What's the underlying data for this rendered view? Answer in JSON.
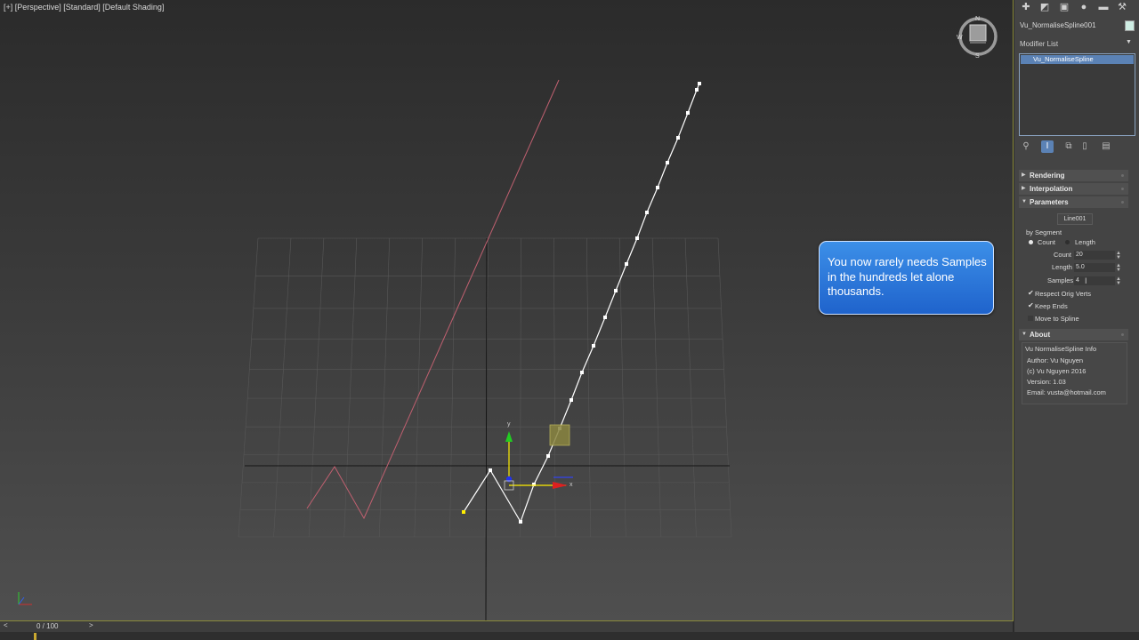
{
  "viewport": {
    "label": "[+] [Perspective] [Standard] [Default Shading]"
  },
  "viewcube": {
    "north": "N",
    "south": "S",
    "west": "W"
  },
  "callout": {
    "text": "You now rarely needs Samples in the hundreds let alone thousands."
  },
  "panel": {
    "object_name": "Vu_NormaliseSpline001",
    "swatch_color": "#cfeee4",
    "modifier_list_label": "Modifier List",
    "modifier_stack": [
      "Vu_NormaliseSpline"
    ],
    "rollouts": {
      "rendering": "Rendering",
      "interpolation": "Interpolation",
      "parameters": "Parameters",
      "about": "About"
    },
    "parameters": {
      "pick_button": "Line001",
      "mode_group": "by Segment",
      "radio_count": "Count",
      "radio_length": "Length",
      "radio_selected": "Count",
      "count_label": "Count",
      "count_value": "20",
      "length_label": "Length",
      "length_value": "5.0",
      "samples_label": "Samples",
      "samples_value": "4",
      "respect_orig_verts": "Respect Orig Verts",
      "respect_orig_verts_checked": true,
      "keep_ends": "Keep Ends",
      "keep_ends_checked": true,
      "move_to_spline": "Move to Spline",
      "move_to_spline_checked": false
    },
    "about": {
      "title": "Vu NormaliseSpline Info",
      "author": "Author: Vu Nguyen",
      "copyright": "(c) Vu Nguyen 2016",
      "version": "Version: 1.03",
      "email": "Email: vusta@hotmail.com"
    }
  },
  "timebar": {
    "prev": "<",
    "frame": "0 / 100",
    "next": ">"
  },
  "colors": {
    "callout": "#2f7ae0",
    "selection": "#5b82b5",
    "original_spline": "#c06070",
    "result_spline": "#ffffff"
  },
  "icons": [
    "create-icon",
    "modify-icon",
    "hierarchy-icon",
    "motion-icon",
    "display-icon",
    "utilities-icon",
    "pin-stack-icon",
    "show-end-result-icon",
    "make-unique-icon",
    "remove-modifier-icon",
    "configure-sets-icon"
  ]
}
